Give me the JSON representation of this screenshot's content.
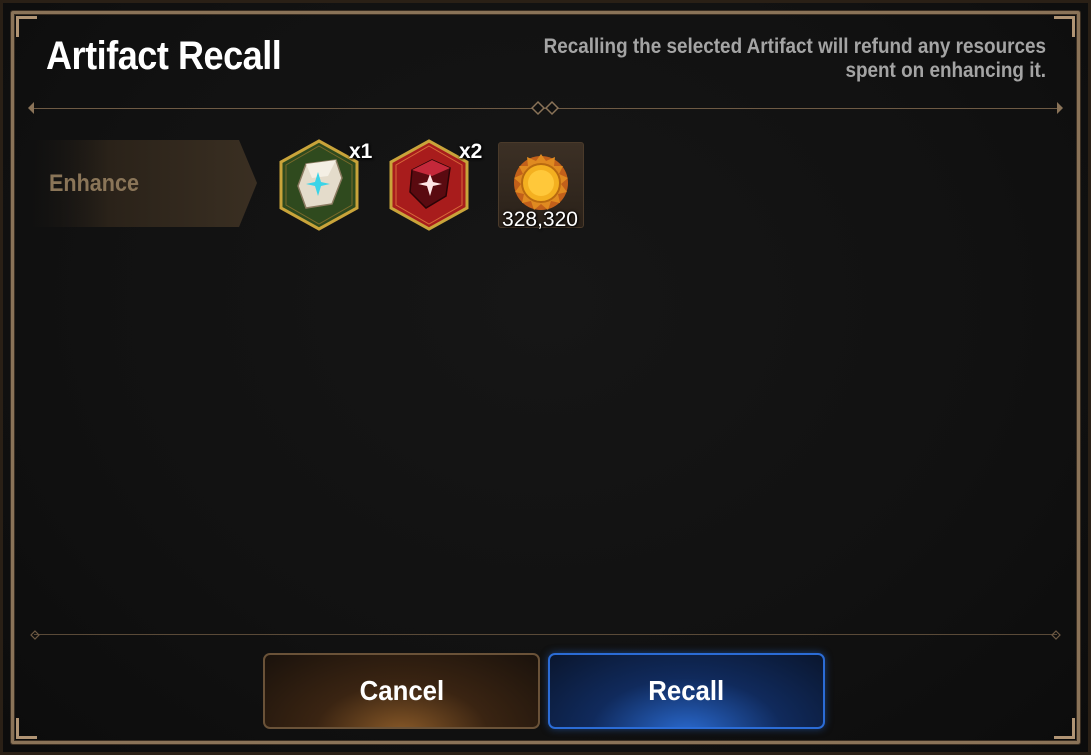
{
  "dialog": {
    "title": "Artifact Recall",
    "description_line1": "Recalling the selected Artifact will refund any resources",
    "description_line2": "spent on enhancing it."
  },
  "section": {
    "label": "Enhance"
  },
  "resources": [
    {
      "icon": "white-crystal-icon",
      "count": "x1",
      "color": "#2f4a1e"
    },
    {
      "icon": "red-crystal-icon",
      "count": "x2",
      "color": "#a81c1c"
    },
    {
      "icon": "gold-coin-icon",
      "amount": "328,320",
      "color": "#f0a020"
    }
  ],
  "buttons": {
    "cancel": "Cancel",
    "recall": "Recall"
  },
  "colors": {
    "frame": "#8a7358",
    "recall_accent": "#2b6cd6",
    "cancel_accent": "#8a5a28"
  }
}
